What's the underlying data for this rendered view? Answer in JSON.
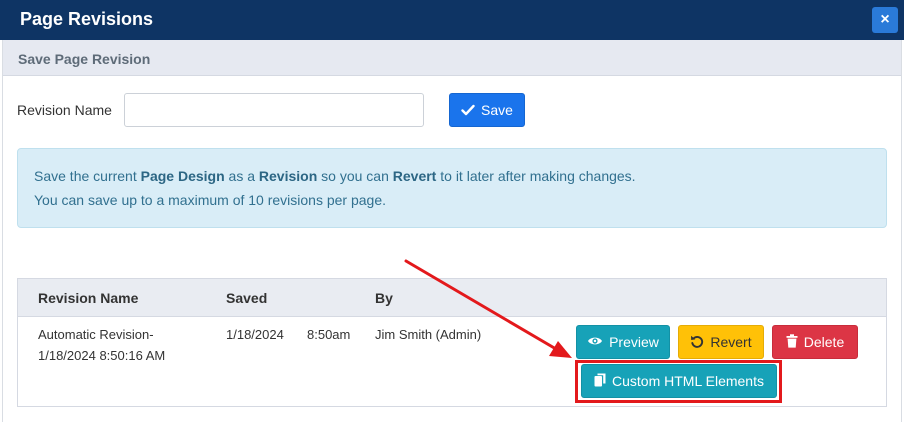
{
  "dialog": {
    "title": "Page Revisions",
    "close_icon": "×"
  },
  "section": {
    "title": "Save Page Revision"
  },
  "form": {
    "revision_name_label": "Revision Name",
    "revision_name_value": "",
    "revision_name_placeholder": "",
    "save_label": "Save"
  },
  "info": {
    "line1_part1": "Save the current ",
    "line1_bold1": "Page Design",
    "line1_part2": " as a ",
    "line1_bold2": "Revision",
    "line1_part3": " so you can ",
    "line1_bold3": "Revert",
    "line1_part4": " to it later after making changes.",
    "line2": "You can save up to a maximum of 10 revisions per page."
  },
  "table": {
    "columns": [
      "Revision Name",
      "Saved",
      "By"
    ],
    "rows": [
      {
        "name_line1": "Automatic Revision-",
        "name_line2": "1/18/2024 8:50:16 AM",
        "saved_date": "1/18/2024",
        "saved_time": "8:50am",
        "by": "Jim Smith (Admin)",
        "actions": {
          "preview": "Preview",
          "revert": "Revert",
          "delete": "Delete",
          "custom_html": "Custom HTML Elements"
        }
      }
    ]
  },
  "colors": {
    "titlebar": "#0e3464",
    "primary": "#1a74ec",
    "info": "#17a2b8",
    "warning": "#ffc107",
    "danger": "#dc3545",
    "annotation": "#e3191c"
  },
  "icons": {
    "close": "close-icon",
    "save": "check-icon",
    "preview": "eye-icon",
    "revert": "undo-icon",
    "delete": "trash-icon",
    "custom_html": "copy-icon"
  }
}
